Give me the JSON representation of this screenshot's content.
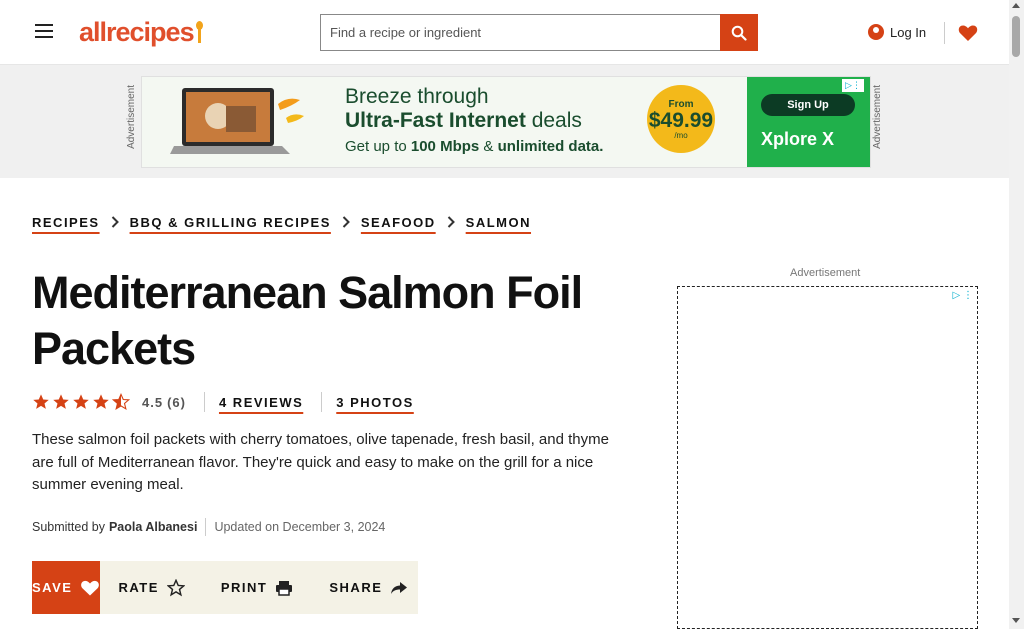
{
  "header": {
    "menu_icon": "hamburger-menu-icon",
    "logo_text": "allrecipes",
    "search_placeholder": "Find a recipe or ingredient",
    "search_icon": "search-icon",
    "login_label": "Log In",
    "login_icon": "user-icon",
    "saved_icon": "heart-icon",
    "brand_color": "#d54215"
  },
  "ad_band": {
    "side_label": "Advertisement",
    "headline_line1": "Breeze through",
    "headline_line2_bold": "Ultra-Fast Internet",
    "headline_line2_rest": " deals",
    "sub_pre": "Get up to ",
    "sub_bold1": "100 Mbps",
    "sub_mid": " & ",
    "sub_bold2": "unlimited data.",
    "price_from": "From",
    "price_amount": "$49.99",
    "price_unit": "/mo",
    "signup": "Sign Up",
    "brand": "Xplore X"
  },
  "breadcrumbs": [
    {
      "label": "RECIPES"
    },
    {
      "label": "BBQ & GRILLING RECIPES"
    },
    {
      "label": "SEAFOOD"
    },
    {
      "label": "SALMON"
    }
  ],
  "recipe": {
    "title": "Mediterranean Salmon Foil Packets",
    "rating_value": "4.5",
    "rating_count": "(6)",
    "reviews_link": "4 REVIEWS",
    "photos_link": "3 PHOTOS",
    "description": "These salmon foil packets with cherry tomatoes, olive tapenade, fresh basil, and thyme are full of Mediterranean flavor. They're quick and easy to make on the grill for a nice summer evening meal.",
    "submitted_prefix": "Submitted by",
    "author": "Paola Albanesi",
    "updated": "Updated on December 3, 2024"
  },
  "actions": {
    "save": "SAVE",
    "rate": "RATE",
    "print": "PRINT",
    "share": "SHARE"
  },
  "right_ad": {
    "label": "Advertisement"
  }
}
